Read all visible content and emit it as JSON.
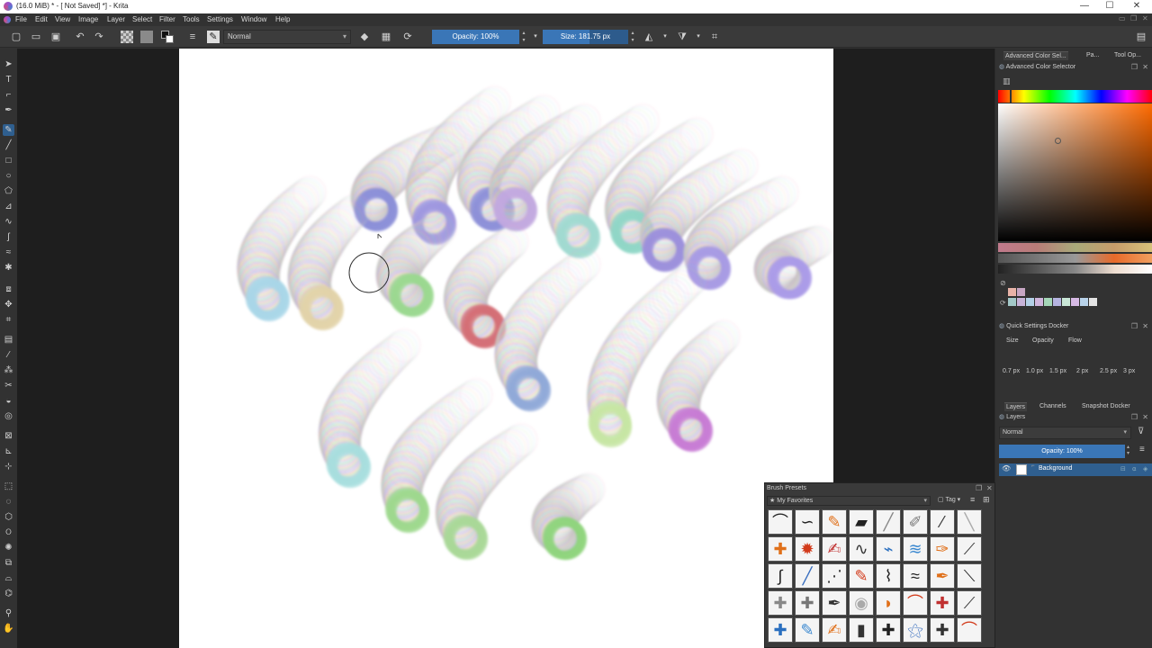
{
  "window": {
    "title": "(16.0 MiB)  * - [ Not Saved]  *] - Krita",
    "minimize": "—",
    "maximize": "☐",
    "close": "✕"
  },
  "menu": [
    "File",
    "Edit",
    "View",
    "Image",
    "Layer",
    "Select",
    "Filter",
    "Tools",
    "Settings",
    "Window",
    "Help"
  ],
  "toolbar": {
    "blend_mode": "Normal",
    "opacity_label": "Opacity: 100%",
    "opacity_value": 1.0,
    "size_label": "Size: 181.75 px",
    "size_fraction": 0.55
  },
  "docker": {
    "top_tabs": [
      "Advanced Color Sel...",
      "Pa...",
      "Tool Op..."
    ],
    "color_selector_title": "Advanced Color Selector",
    "quick_settings_title": "Quick Settings Docker",
    "quick_tabs": [
      "Size",
      "Opacity",
      "Flow"
    ],
    "size_presets": [
      "0.7 px",
      "1.0 px",
      "1.5 px",
      "2 px",
      "2.5 px",
      "3 px"
    ],
    "layer_tabs": [
      "Layers",
      "Channels",
      "Snapshot Docker"
    ],
    "layers_title": "Layers",
    "layer_blend": "Normal",
    "layer_opacity": "Opacity:  100%",
    "layers": [
      {
        "name": "Background"
      }
    ]
  },
  "brush_presets": {
    "title": "Brush Presets",
    "tag": "My Favorites",
    "tag_button": "Tag"
  },
  "colors": {
    "accent": "#3a76b7",
    "panel": "#323232",
    "canvas": "#ffffff"
  }
}
